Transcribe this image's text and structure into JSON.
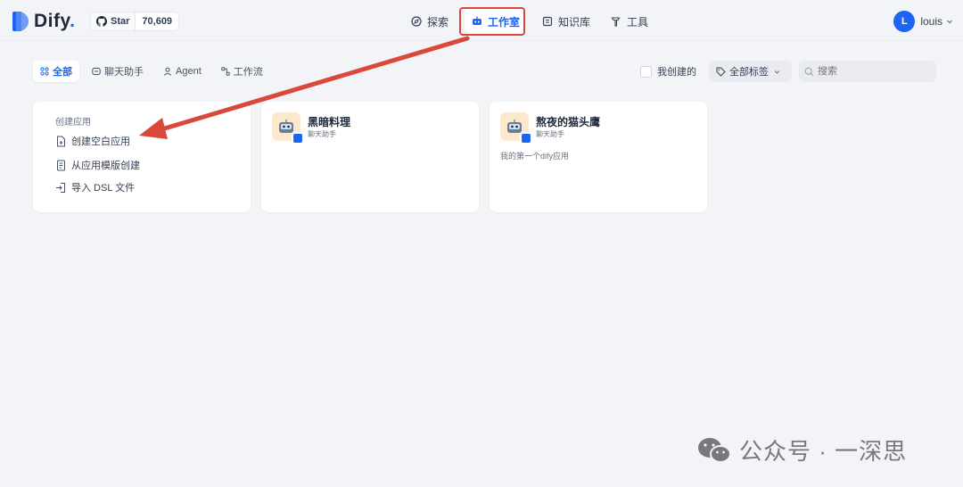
{
  "brand": {
    "name": "Dify",
    "suffix": "."
  },
  "github": {
    "label": "Star",
    "count": "70,609"
  },
  "nav": {
    "explore": "探索",
    "studio": "工作室",
    "knowledge": "知识库",
    "tools": "工具"
  },
  "user": {
    "initial": "L",
    "name": "louis"
  },
  "tabs": {
    "all": "全部",
    "chat": "聊天助手",
    "agent": "Agent",
    "workflow": "工作流"
  },
  "filters": {
    "mine": "我创建的",
    "tags": "全部标签",
    "search_placeholder": "搜索"
  },
  "create": {
    "title": "创建应用",
    "blank": "创建空白应用",
    "template": "从应用模版创建",
    "import": "导入 DSL 文件"
  },
  "apps": [
    {
      "name": "黑暗料理",
      "type": "聊天助手",
      "desc": ""
    },
    {
      "name": "熬夜的猫头鹰",
      "type": "聊天助手",
      "desc": "我的第一个dify应用"
    }
  ],
  "watermark": "公众号 · 一深思",
  "colors": {
    "accent": "#1c64f2",
    "annotation": "#d9483b"
  }
}
